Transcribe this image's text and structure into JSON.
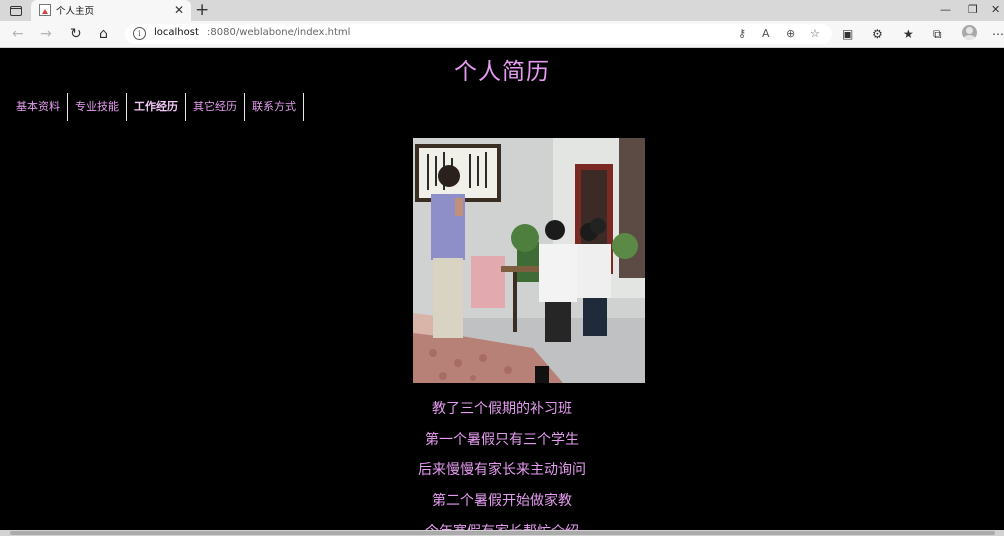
{
  "browser": {
    "tab_title": "个人主页",
    "url_host": "localhost",
    "url_path": ":8080/weblabone/index.html"
  },
  "page": {
    "title": "个人简历",
    "nav": [
      {
        "label": "基本资料",
        "active": false
      },
      {
        "label": "专业技能",
        "active": false
      },
      {
        "label": "工作经历",
        "active": true
      },
      {
        "label": "其它经历",
        "active": false
      },
      {
        "label": "联系方式",
        "active": false
      }
    ],
    "lines": [
      "教了三个假期的补习班",
      "第一个暑假只有三个学生",
      "后来慢慢有家长来主动询问",
      "第二个暑假开始做家教",
      "今年寒假有家长帮忙介绍"
    ]
  },
  "colors": {
    "accent": "#e59cf0",
    "background": "#000000"
  }
}
